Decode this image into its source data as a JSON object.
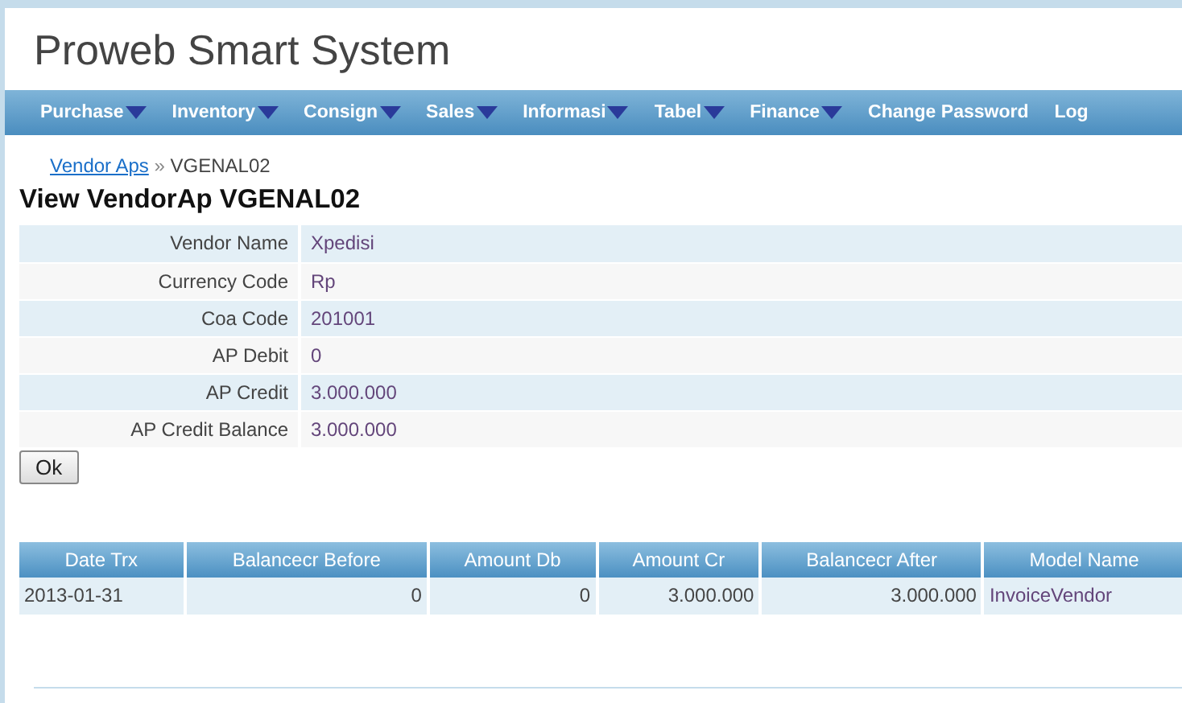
{
  "header": {
    "title": "Proweb Smart System"
  },
  "menu": [
    {
      "label": "Purchase",
      "kind": "dropdown"
    },
    {
      "label": "Inventory",
      "kind": "dropdown"
    },
    {
      "label": "Consign",
      "kind": "dropdown"
    },
    {
      "label": "Sales",
      "kind": "dropdown"
    },
    {
      "label": "Informasi",
      "kind": "dropdown"
    },
    {
      "label": "Tabel",
      "kind": "dropdown"
    },
    {
      "label": "Finance",
      "kind": "dropdown"
    },
    {
      "label": "Change Password",
      "kind": "link"
    },
    {
      "label": "Log",
      "kind": "link"
    }
  ],
  "breadcrumb": {
    "link": "Vendor Aps",
    "separator": "»",
    "current": "VGENAL02"
  },
  "heading": "View VendorAp VGENAL02",
  "details": [
    {
      "label": "Vendor Name",
      "value": "Xpedisi"
    },
    {
      "label": "Currency Code",
      "value": "Rp"
    },
    {
      "label": "Coa Code",
      "value": "201001"
    },
    {
      "label": "AP Debit",
      "value": "0"
    },
    {
      "label": "AP Credit",
      "value": "3.000.000"
    },
    {
      "label": "AP Credit Balance",
      "value": "3.000.000"
    }
  ],
  "ok_button": "Ok",
  "table": {
    "columns": [
      "Date Trx",
      "Balancecr Before",
      "Amount Db",
      "Amount Cr",
      "Balancecr After",
      "Model Name"
    ],
    "rows": [
      [
        "2013-01-31",
        "0",
        "0",
        "3.000.000",
        "3.000.000",
        "InvoiceVendor"
      ]
    ]
  }
}
